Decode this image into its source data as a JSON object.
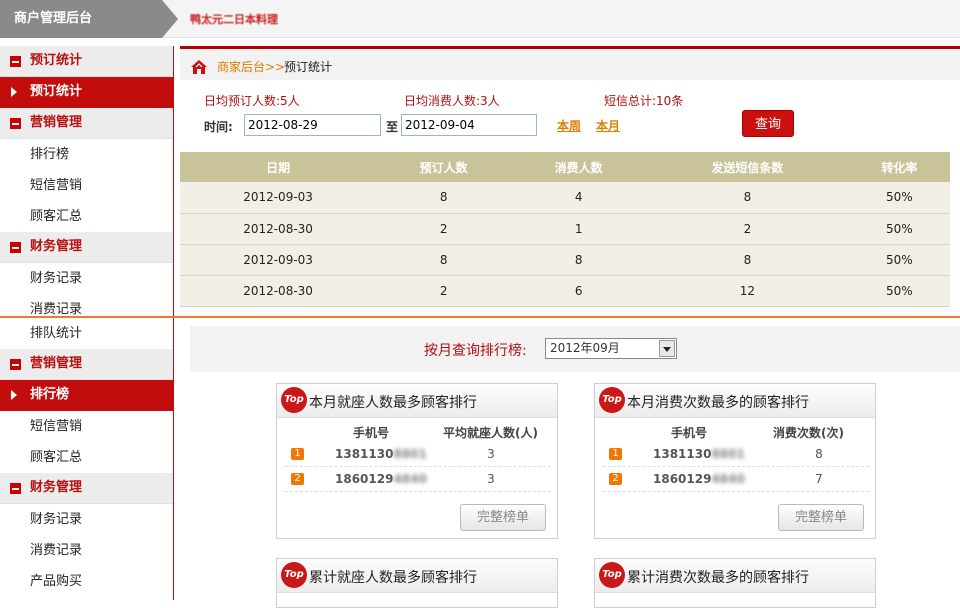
{
  "topbar": {
    "brand": "商户管理后台",
    "shop_name": "鸭太元二日本料理"
  },
  "sidebar_top": [
    {
      "type": "header",
      "label": "预订统计"
    },
    {
      "type": "active",
      "label": "预订统计"
    },
    {
      "type": "header",
      "label": "营销管理"
    },
    {
      "type": "item",
      "label": "排行榜"
    },
    {
      "type": "item",
      "label": "短信营销"
    },
    {
      "type": "item",
      "label": "顾客汇总"
    },
    {
      "type": "header",
      "label": "财务管理"
    },
    {
      "type": "item",
      "label": "财务记录"
    },
    {
      "type": "item",
      "label": "消费记录"
    }
  ],
  "sidebar_bottom": [
    {
      "type": "item",
      "label": "排队统计"
    },
    {
      "type": "header",
      "label": "营销管理"
    },
    {
      "type": "active",
      "label": "排行榜"
    },
    {
      "type": "item",
      "label": "短信营销"
    },
    {
      "type": "item",
      "label": "顾客汇总"
    },
    {
      "type": "header",
      "label": "财务管理"
    },
    {
      "type": "item",
      "label": "财务记录"
    },
    {
      "type": "item",
      "label": "消费记录"
    },
    {
      "type": "item",
      "label": "产品购买"
    }
  ],
  "breadcrumb": {
    "home": "商家后台>>",
    "current": "预订统计"
  },
  "stats": {
    "avg_booking": "日均预订人数:5人",
    "avg_consume": "日均消费人数:3人",
    "sms_total": "短信总计:10条"
  },
  "filter": {
    "time_label": "时间:",
    "from": "2012-08-29",
    "to_label": "至",
    "to": "2012-09-04",
    "this_week": "本周",
    "this_month": "本月",
    "query": "查询"
  },
  "table": {
    "headers": [
      "日期",
      "预订人数",
      "消费人数",
      "发送短信条数",
      "转化率"
    ],
    "rows": [
      [
        "2012-09-03",
        "8",
        "4",
        "8",
        "50%"
      ],
      [
        "2012-08-30",
        "2",
        "1",
        "2",
        "50%"
      ],
      [
        "2012-09-03",
        "8",
        "8",
        "8",
        "50%"
      ],
      [
        "2012-08-30",
        "2",
        "6",
        "12",
        "50%"
      ]
    ]
  },
  "month_query": {
    "label": "按月查询排行榜:",
    "selected": "2012年09月"
  },
  "cards": [
    {
      "title": "本月就座人数最多顾客排行",
      "col1": "手机号",
      "col2": "平均就座人数(人)",
      "rows": [
        {
          "rank": "1",
          "phone": "13811308801",
          "value": "3"
        },
        {
          "rank": "2",
          "phone": "18601294840",
          "value": "3"
        }
      ],
      "button": "完整榜单"
    },
    {
      "title": "本月消费次数最多的顾客排行",
      "col1": "手机号",
      "col2": "消费次数(次)",
      "rows": [
        {
          "rank": "1",
          "phone": "13811308801",
          "value": "8"
        },
        {
          "rank": "2",
          "phone": "18601294840",
          "value": "7"
        }
      ],
      "button": "完整榜单"
    },
    {
      "title": "累计就座人数最多顾客排行"
    },
    {
      "title": "累计消费次数最多的顾客排行"
    }
  ],
  "icon_text": "Top"
}
